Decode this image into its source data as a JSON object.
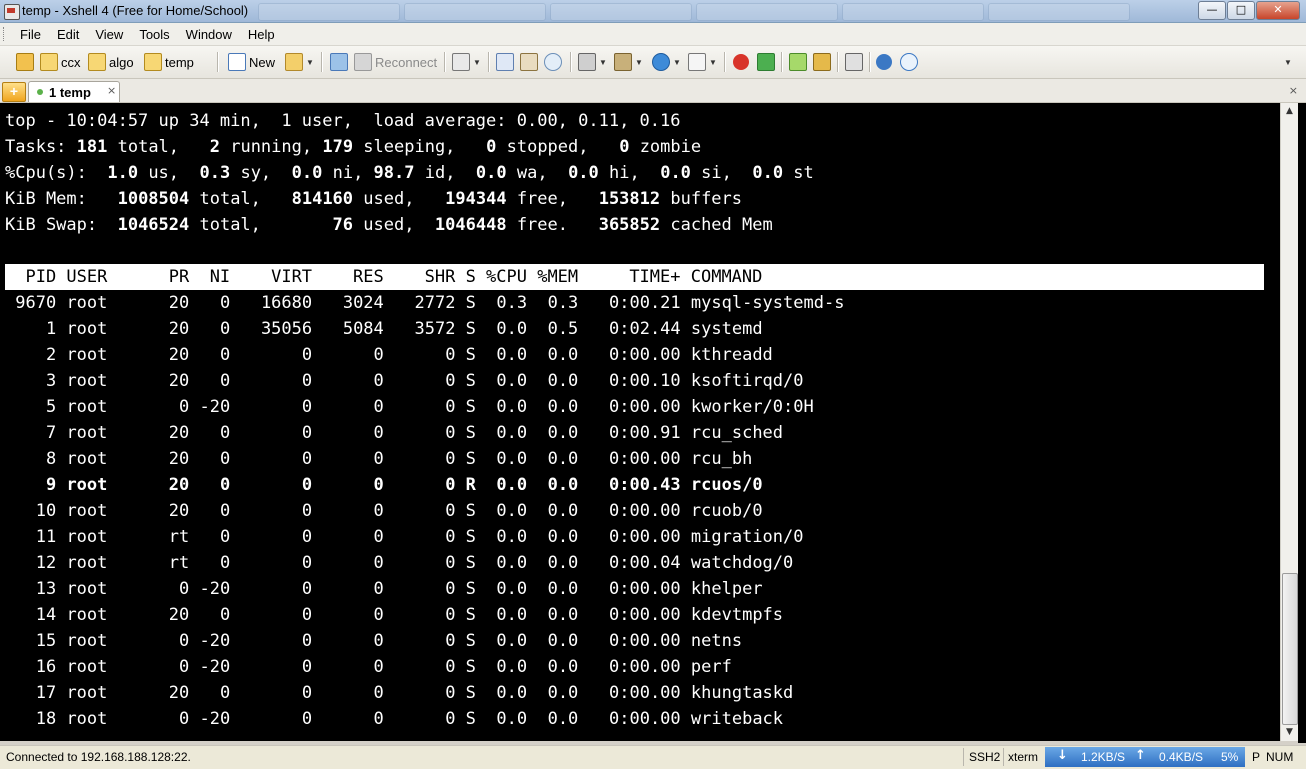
{
  "window": {
    "title": "temp - Xshell 4 (Free for Home/School)",
    "buttons": [
      "—",
      "□",
      "✕"
    ]
  },
  "menu": [
    "File",
    "Edit",
    "View",
    "Tools",
    "Window",
    "Help"
  ],
  "toolbar": {
    "links": [
      "ccx",
      "algo",
      "temp"
    ],
    "new_label": "New",
    "reconnect_label": "Reconnect"
  },
  "tabs": [
    {
      "label": "1 temp",
      "close": "×"
    }
  ],
  "tabbar_close": "×",
  "terminal": {
    "summary": [
      [
        {
          "t": "top - 10:04:57 up 34 min,  1 user,  load average: 0.00, 0.11, 0.16"
        }
      ],
      [
        {
          "t": "Tasks: "
        },
        {
          "t": "181",
          "b": true
        },
        {
          "t": " total,   "
        },
        {
          "t": "2",
          "b": true
        },
        {
          "t": " running, "
        },
        {
          "t": "179",
          "b": true
        },
        {
          "t": " sleeping,   "
        },
        {
          "t": "0",
          "b": true
        },
        {
          "t": " stopped,   "
        },
        {
          "t": "0",
          "b": true
        },
        {
          "t": " zombie"
        }
      ],
      [
        {
          "t": "%Cpu(s):  "
        },
        {
          "t": "1.0",
          "b": true
        },
        {
          "t": " us,  "
        },
        {
          "t": "0.3",
          "b": true
        },
        {
          "t": " sy,  "
        },
        {
          "t": "0.0",
          "b": true
        },
        {
          "t": " ni, "
        },
        {
          "t": "98.7",
          "b": true
        },
        {
          "t": " id,  "
        },
        {
          "t": "0.0",
          "b": true
        },
        {
          "t": " wa,  "
        },
        {
          "t": "0.0",
          "b": true
        },
        {
          "t": " hi,  "
        },
        {
          "t": "0.0",
          "b": true
        },
        {
          "t": " si,  "
        },
        {
          "t": "0.0",
          "b": true
        },
        {
          "t": " st"
        }
      ],
      [
        {
          "t": "KiB Mem:   "
        },
        {
          "t": "1008504",
          "b": true
        },
        {
          "t": " total,   "
        },
        {
          "t": "814160",
          "b": true
        },
        {
          "t": " used,   "
        },
        {
          "t": "194344",
          "b": true
        },
        {
          "t": " free,   "
        },
        {
          "t": "153812",
          "b": true
        },
        {
          "t": " buffers"
        }
      ],
      [
        {
          "t": "KiB Swap:  "
        },
        {
          "t": "1046524",
          "b": true
        },
        {
          "t": " total,       "
        },
        {
          "t": "76",
          "b": true
        },
        {
          "t": " used,  "
        },
        {
          "t": "1046448",
          "b": true
        },
        {
          "t": " free.   "
        },
        {
          "t": "365852",
          "b": true
        },
        {
          "t": " cached Mem"
        }
      ]
    ],
    "header": "  PID USER      PR  NI    VIRT    RES    SHR S %CPU %MEM     TIME+ COMMAND",
    "processes": [
      {
        "pid": "9670",
        "user": "root",
        "pr": "20",
        "ni": "0",
        "virt": "16680",
        "res": "3024",
        "shr": "2772",
        "s": "S",
        "cpu": "0.3",
        "mem": "0.3",
        "time": "0:00.21",
        "cmd": "mysql-systemd-s"
      },
      {
        "pid": "1",
        "user": "root",
        "pr": "20",
        "ni": "0",
        "virt": "35056",
        "res": "5084",
        "shr": "3572",
        "s": "S",
        "cpu": "0.0",
        "mem": "0.5",
        "time": "0:02.44",
        "cmd": "systemd"
      },
      {
        "pid": "2",
        "user": "root",
        "pr": "20",
        "ni": "0",
        "virt": "0",
        "res": "0",
        "shr": "0",
        "s": "S",
        "cpu": "0.0",
        "mem": "0.0",
        "time": "0:00.00",
        "cmd": "kthreadd"
      },
      {
        "pid": "3",
        "user": "root",
        "pr": "20",
        "ni": "0",
        "virt": "0",
        "res": "0",
        "shr": "0",
        "s": "S",
        "cpu": "0.0",
        "mem": "0.0",
        "time": "0:00.10",
        "cmd": "ksoftirqd/0"
      },
      {
        "pid": "5",
        "user": "root",
        "pr": "0",
        "ni": "-20",
        "virt": "0",
        "res": "0",
        "shr": "0",
        "s": "S",
        "cpu": "0.0",
        "mem": "0.0",
        "time": "0:00.00",
        "cmd": "kworker/0:0H"
      },
      {
        "pid": "7",
        "user": "root",
        "pr": "20",
        "ni": "0",
        "virt": "0",
        "res": "0",
        "shr": "0",
        "s": "S",
        "cpu": "0.0",
        "mem": "0.0",
        "time": "0:00.91",
        "cmd": "rcu_sched"
      },
      {
        "pid": "8",
        "user": "root",
        "pr": "20",
        "ni": "0",
        "virt": "0",
        "res": "0",
        "shr": "0",
        "s": "S",
        "cpu": "0.0",
        "mem": "0.0",
        "time": "0:00.00",
        "cmd": "rcu_bh"
      },
      {
        "pid": "9",
        "user": "root",
        "pr": "20",
        "ni": "0",
        "virt": "0",
        "res": "0",
        "shr": "0",
        "s": "R",
        "cpu": "0.0",
        "mem": "0.0",
        "time": "0:00.43",
        "cmd": "rcuos/0",
        "bold": true
      },
      {
        "pid": "10",
        "user": "root",
        "pr": "20",
        "ni": "0",
        "virt": "0",
        "res": "0",
        "shr": "0",
        "s": "S",
        "cpu": "0.0",
        "mem": "0.0",
        "time": "0:00.00",
        "cmd": "rcuob/0"
      },
      {
        "pid": "11",
        "user": "root",
        "pr": "rt",
        "ni": "0",
        "virt": "0",
        "res": "0",
        "shr": "0",
        "s": "S",
        "cpu": "0.0",
        "mem": "0.0",
        "time": "0:00.00",
        "cmd": "migration/0"
      },
      {
        "pid": "12",
        "user": "root",
        "pr": "rt",
        "ni": "0",
        "virt": "0",
        "res": "0",
        "shr": "0",
        "s": "S",
        "cpu": "0.0",
        "mem": "0.0",
        "time": "0:00.04",
        "cmd": "watchdog/0"
      },
      {
        "pid": "13",
        "user": "root",
        "pr": "0",
        "ni": "-20",
        "virt": "0",
        "res": "0",
        "shr": "0",
        "s": "S",
        "cpu": "0.0",
        "mem": "0.0",
        "time": "0:00.00",
        "cmd": "khelper"
      },
      {
        "pid": "14",
        "user": "root",
        "pr": "20",
        "ni": "0",
        "virt": "0",
        "res": "0",
        "shr": "0",
        "s": "S",
        "cpu": "0.0",
        "mem": "0.0",
        "time": "0:00.00",
        "cmd": "kdevtmpfs"
      },
      {
        "pid": "15",
        "user": "root",
        "pr": "0",
        "ni": "-20",
        "virt": "0",
        "res": "0",
        "shr": "0",
        "s": "S",
        "cpu": "0.0",
        "mem": "0.0",
        "time": "0:00.00",
        "cmd": "netns"
      },
      {
        "pid": "16",
        "user": "root",
        "pr": "0",
        "ni": "-20",
        "virt": "0",
        "res": "0",
        "shr": "0",
        "s": "S",
        "cpu": "0.0",
        "mem": "0.0",
        "time": "0:00.00",
        "cmd": "perf"
      },
      {
        "pid": "17",
        "user": "root",
        "pr": "20",
        "ni": "0",
        "virt": "0",
        "res": "0",
        "shr": "0",
        "s": "S",
        "cpu": "0.0",
        "mem": "0.0",
        "time": "0:00.00",
        "cmd": "khungtaskd"
      },
      {
        "pid": "18",
        "user": "root",
        "pr": "0",
        "ni": "-20",
        "virt": "0",
        "res": "0",
        "shr": "0",
        "s": "S",
        "cpu": "0.0",
        "mem": "0.0",
        "time": "0:00.00",
        "cmd": "writeback"
      }
    ]
  },
  "status": {
    "connection": "Connected to 192.168.188.128:22.",
    "protocol": "SSH2",
    "terminal_type": "xterm",
    "download": "1.2KB/S",
    "upload": "0.4KB/S",
    "percent": "5%",
    "cap_p": "P",
    "num": "NUM"
  },
  "colors": {
    "terminal_bg": "#000000",
    "terminal_fg": "#ffffff",
    "header_bg": "#ffffff",
    "network_box": "#2e6fc2"
  }
}
